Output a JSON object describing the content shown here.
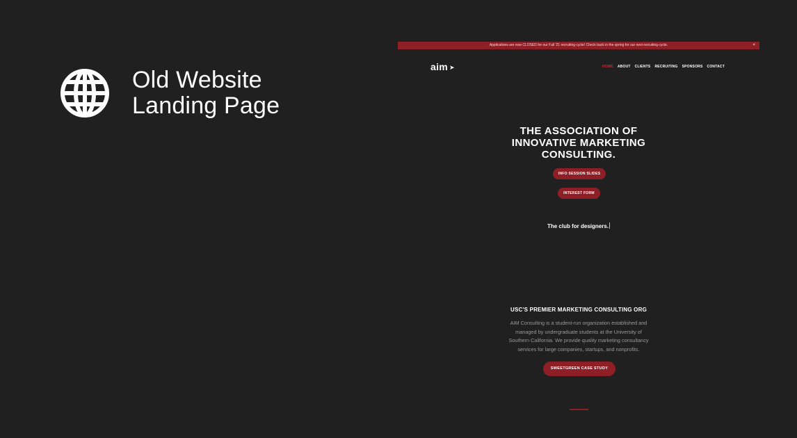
{
  "slide": {
    "icon": "globe-icon",
    "title_line1": "Old Website",
    "title_line2": "Landing Page"
  },
  "site": {
    "banner": {
      "text": "Applications are now CLOSED for our Fall '21 recruiting cycle! Check back in the spring for our next recruiting cycle.",
      "close": "×"
    },
    "logo": "aim",
    "logo_icon": "arrow-icon",
    "nav": [
      "HOME",
      "ABOUT",
      "CLIENTS",
      "RECRUITING",
      "SPONSORS",
      "CONTACT"
    ],
    "hero": {
      "title_line1": "THE ASSOCIATION OF",
      "title_line2": "INNOVATIVE MARKETING",
      "title_line3": "CONSULTING.",
      "btn_info": "INFO SESSION SLIDES",
      "btn_interest": "INTEREST FORM",
      "tagline": "The club for designers."
    },
    "about": {
      "title": "USC'S PREMIER MARKETING CONSULTING ORG",
      "desc_line1": "AIM Consulting is a student-run organization established and",
      "desc_line2": "managed by undergraduate students at the University of",
      "desc_line3": "Southern California. We provide quality marketing consultancy",
      "desc_line4": "services for large companies, startups, and nonprofits.",
      "btn_case": "SWEETGREEN CASE STUDY"
    },
    "colors": {
      "accent": "#8e1f26",
      "background": "#202020",
      "active_nav": "#c53039"
    }
  }
}
